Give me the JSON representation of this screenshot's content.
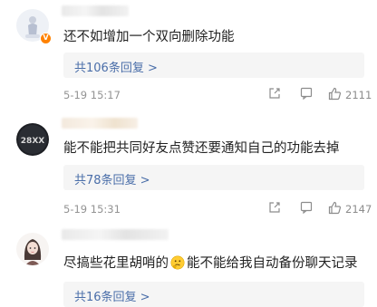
{
  "comments": [
    {
      "text": "还不如增加一个双向删除功能",
      "replies_label": "共106条回复 >",
      "time": "5-19 15:17",
      "likes": "2111",
      "verified_badge": "V",
      "avatar_icon": "cartoon-figure-avatar"
    },
    {
      "text": "能不能把共同好友点赞还要通知自己的功能去掉",
      "replies_label": "共78条回复 >",
      "time": "5-19 15:31",
      "likes": "2147",
      "avatar_label": "28XX",
      "avatar_icon": "dark-logo-avatar"
    },
    {
      "text_before": "尽搞些花里胡哨的",
      "emoji_icon": "thinking-face-emoji",
      "text_after": "能不能给我自动备份聊天记录",
      "replies_label": "共16条回复 >",
      "avatar_icon": "girl-illustration-avatar"
    }
  ],
  "icons": {
    "share": "share-icon",
    "comment": "comment-icon",
    "like": "thumbs-up-icon"
  },
  "colors": {
    "link": "#4a6ea9",
    "meta": "#939393",
    "verified": "#ff8200"
  }
}
